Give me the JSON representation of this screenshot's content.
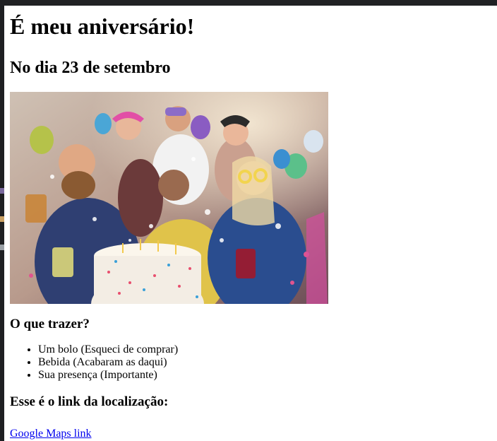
{
  "page": {
    "title": "É meu aniversário!",
    "date_heading": "No dia 23 de setembro",
    "bring_heading": "O que trazer?",
    "bring_items": [
      "Um bolo (Esqueci de comprar)",
      "Bebida (Acabaram as daqui)",
      "Sua presença (Importante)"
    ],
    "location_heading": "Esse é o link da localização:",
    "map_link_text": "Google Maps link"
  },
  "colors": {
    "link": "#0000ee",
    "window_chrome": "#202124"
  }
}
